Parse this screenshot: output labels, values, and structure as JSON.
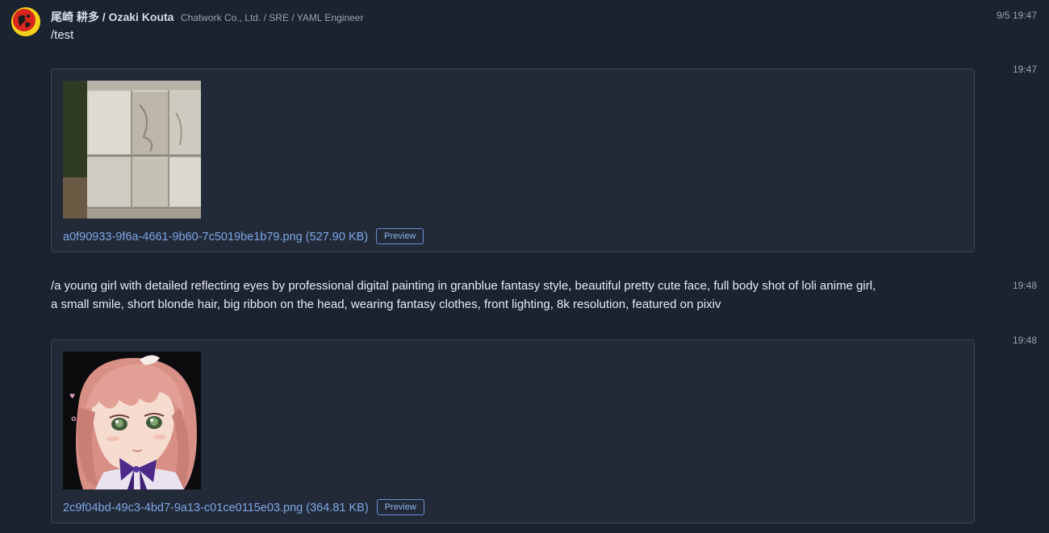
{
  "message_header": {
    "sender_name": "尾崎 耕多 / Ozaki Kouta",
    "sender_org": "Chatwork Co., Ltd. / SRE / YAML Engineer",
    "timestamp": "9/5 19:47"
  },
  "messages": [
    {
      "text": "/test",
      "time": ""
    },
    {
      "time": "19:47",
      "attachment": {
        "filename": "a0f90933-9f6a-4661-9b60-7c5019be1b79.png",
        "size": "(527.90 KB)",
        "preview_label": "Preview",
        "thumbnail": "stone-wall-image"
      }
    },
    {
      "text_line1": "/a young girl with detailed reflecting eyes by professional digital painting in granblue fantasy style, beautiful pretty cute face, full body shot of loli anime girl,",
      "text_line2": "a small smile, short blonde hair, big ribbon on the head, wearing fantasy clothes, front lighting, 8k resolution, featured on pixiv",
      "time": "19:48"
    },
    {
      "time": "19:48",
      "attachment": {
        "filename": "2c9f04bd-49c3-4bd7-9a13-c01ce0115e03.png",
        "size": "(364.81 KB)",
        "preview_label": "Preview",
        "thumbnail": "anime-girl-image"
      }
    }
  ],
  "colors": {
    "background": "#1b2230",
    "card_background": "#222a37",
    "link": "#7ea6e8",
    "avatar_yellow": "#f2d21a",
    "avatar_red": "#d8261f"
  }
}
